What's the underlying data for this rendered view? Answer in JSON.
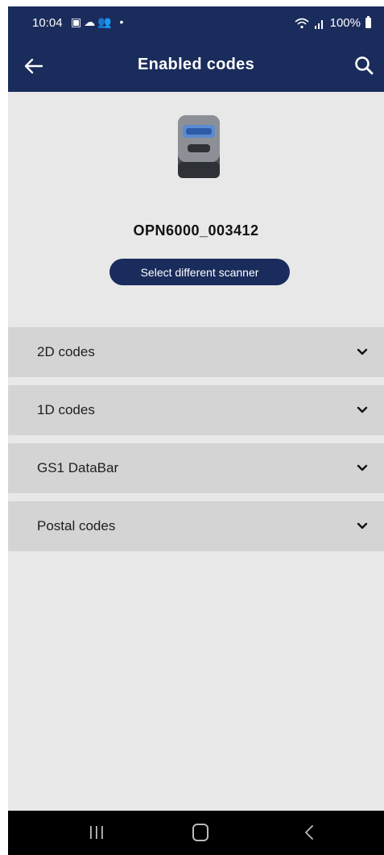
{
  "status_bar": {
    "time": "10:04",
    "left_icons": "▣☁👥 •",
    "signal": "⋉ .∥",
    "battery": "100%"
  },
  "app_bar": {
    "title": "Enabled codes",
    "back_icon": "arrow-left-icon",
    "search_icon": "search-icon"
  },
  "scanner": {
    "name": "OPN6000_003412",
    "select_button_label": "Select different scanner"
  },
  "sections": [
    {
      "label": "2D codes"
    },
    {
      "label": "1D codes"
    },
    {
      "label": "GS1 DataBar"
    },
    {
      "label": "Postal codes"
    }
  ],
  "colors": {
    "primary": "#1a2c5b",
    "background": "#e8e8e8",
    "section_bg": "#d4d4d4"
  }
}
